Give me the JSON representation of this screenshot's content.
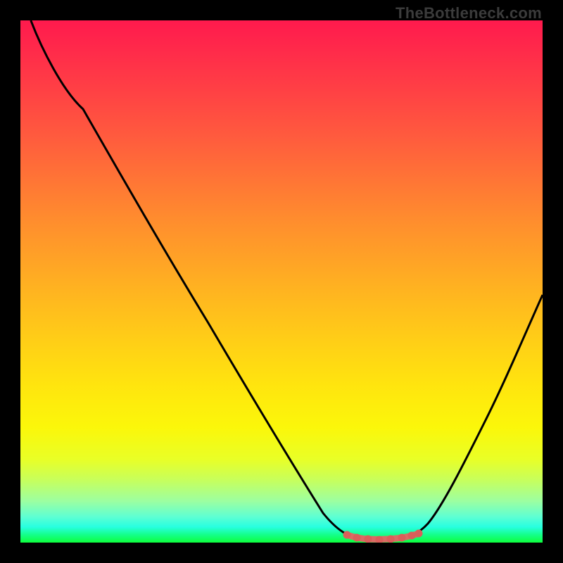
{
  "watermark": "TheBottleneck.com",
  "colors": {
    "curve": "#000000",
    "valley_stroke": "#db6a64",
    "valley_dot": "#da5f5a",
    "background": "#000000"
  },
  "chart_data": {
    "type": "line",
    "title": "",
    "xlabel": "",
    "ylabel": "",
    "xlim": [
      0,
      100
    ],
    "ylim": [
      0,
      100
    ],
    "grid": false,
    "series": [
      {
        "name": "bottleneck-curve",
        "x": [
          2,
          6,
          12,
          18,
          24,
          30,
          36,
          42,
          48,
          54,
          58,
          62,
          65,
          68,
          72,
          75,
          78,
          82,
          86,
          90,
          94,
          98
        ],
        "values": [
          100,
          93,
          83,
          73,
          63,
          53,
          43,
          34,
          24,
          14,
          8,
          3,
          1,
          1,
          1,
          2,
          5,
          12,
          21,
          31,
          42,
          54
        ]
      }
    ],
    "valley": {
      "x_start": 63,
      "x_end": 76,
      "y": 1,
      "points_x": [
        63,
        65,
        67,
        69,
        71,
        73,
        75,
        76
      ],
      "points_y": [
        1.6,
        1.2,
        1.0,
        1.0,
        1.0,
        1.2,
        1.6,
        2.0
      ]
    },
    "gradient_stops": [
      {
        "pct": 0,
        "color": "#ff1a4d"
      },
      {
        "pct": 14,
        "color": "#ff4244"
      },
      {
        "pct": 30,
        "color": "#ff7336"
      },
      {
        "pct": 46,
        "color": "#ffa326"
      },
      {
        "pct": 62,
        "color": "#ffd016"
      },
      {
        "pct": 78,
        "color": "#fbf70a"
      },
      {
        "pct": 92,
        "color": "#9dffa0"
      },
      {
        "pct": 100,
        "color": "#0eff3c"
      }
    ]
  }
}
